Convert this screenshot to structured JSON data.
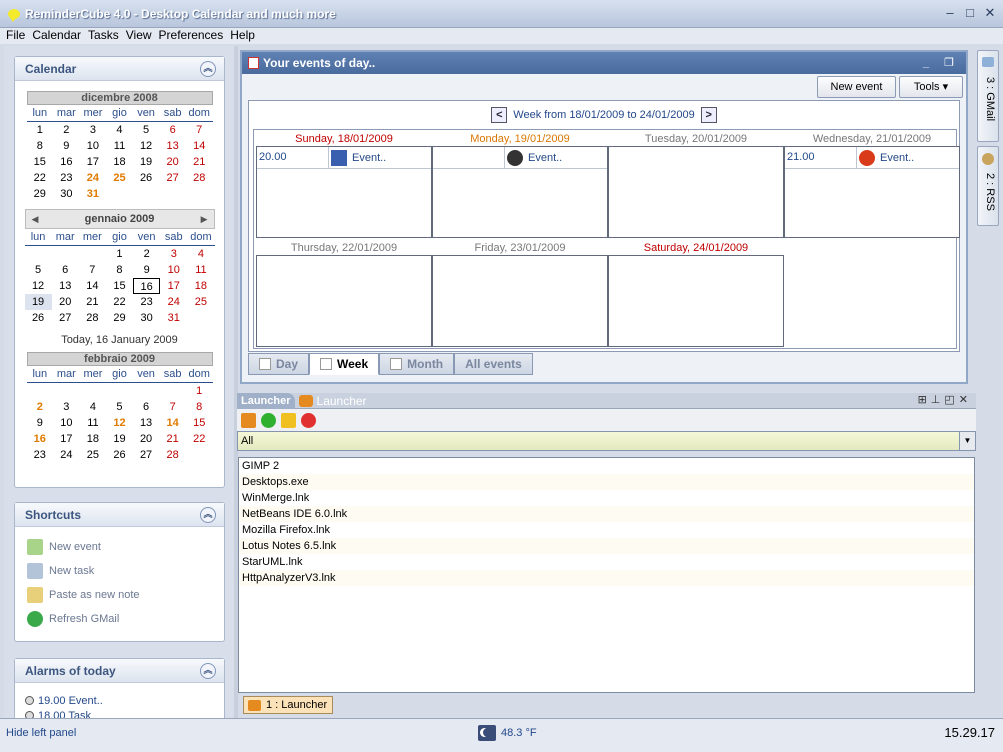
{
  "window": {
    "title": "ReminderCube 4.0 - Desktop Calendar and much more"
  },
  "menu": [
    "File",
    "Calendar",
    "Tasks",
    "View",
    "Preferences",
    "Help"
  ],
  "calendar_panel": {
    "title": "Calendar",
    "day_names": [
      "lun",
      "mar",
      "mer",
      "gio",
      "ven",
      "sab",
      "dom"
    ],
    "prev_month": {
      "title": "dicembre 2008",
      "rows": [
        [
          "1",
          "2",
          "3",
          "4",
          "5",
          "6",
          "7"
        ],
        [
          "8",
          "9",
          "10",
          "11",
          "12",
          "13",
          "14"
        ],
        [
          "15",
          "16",
          "17",
          "18",
          "19",
          "20",
          "21"
        ],
        [
          "22",
          "23",
          "24",
          "25",
          "26",
          "27",
          "28"
        ],
        [
          "29",
          "30",
          "31",
          "",
          "",
          "",
          ""
        ]
      ]
    },
    "cur_month": {
      "title": "gennaio 2009",
      "rows": [
        [
          "",
          "",
          "",
          "1",
          "2",
          "3",
          "4"
        ],
        [
          "5",
          "6",
          "7",
          "8",
          "9",
          "10",
          "11"
        ],
        [
          "12",
          "13",
          "14",
          "15",
          "16",
          "17",
          "18"
        ],
        [
          "19",
          "20",
          "21",
          "22",
          "23",
          "24",
          "25"
        ],
        [
          "26",
          "27",
          "28",
          "29",
          "30",
          "31",
          ""
        ]
      ]
    },
    "today_text": "Today, 16 January 2009",
    "next_month": {
      "title": "febbraio 2009",
      "rows": [
        [
          "",
          "",
          "",
          "",
          "",
          "",
          "1"
        ],
        [
          "2",
          "3",
          "4",
          "5",
          "6",
          "7",
          "8"
        ],
        [
          "9",
          "10",
          "11",
          "12",
          "13",
          "14",
          "15"
        ],
        [
          "16",
          "17",
          "18",
          "19",
          "20",
          "21",
          "22"
        ],
        [
          "23",
          "24",
          "25",
          "26",
          "27",
          "28",
          ""
        ]
      ]
    }
  },
  "shortcuts": {
    "title": "Shortcuts",
    "items": [
      "New event",
      "New task",
      "Paste as new note",
      "Refresh GMail"
    ]
  },
  "alarms": {
    "title": "Alarms of today",
    "items": [
      "19.00 Event..",
      "18.00 Task"
    ]
  },
  "events_window": {
    "title": "Your events of day..",
    "new_event": "New event",
    "tools": "Tools",
    "week_label": "Week from 18/01/2009 to 24/01/2009",
    "days": [
      {
        "name": "Sunday, 18/01/2009",
        "time": "20.00",
        "event": "Event.."
      },
      {
        "name": "Monday, 19/01/2009",
        "time": "",
        "event": "Event.."
      },
      {
        "name": "Tuesday, 20/01/2009",
        "time": "",
        "event": ""
      },
      {
        "name": "Wednesday, 21/01/2009",
        "time": "21.00",
        "event": "Event.."
      },
      {
        "name": "Thursday, 22/01/2009",
        "time": "",
        "event": ""
      },
      {
        "name": "Friday, 23/01/2009",
        "time": "",
        "event": ""
      },
      {
        "name": "Saturday, 24/01/2009",
        "time": "",
        "event": ""
      }
    ],
    "tabs": [
      "Day",
      "Week",
      "Month",
      "All events"
    ]
  },
  "launcher": {
    "tab_active": "Launcher",
    "tab_title": "Launcher",
    "filter": "All",
    "items": [
      "GIMP 2",
      "Desktops.exe",
      "WinMerge.lnk",
      "NetBeans IDE 6.0.lnk",
      "Mozilla Firefox.lnk",
      "Lotus Notes 6.5.lnk",
      "StarUML.lnk",
      "HttpAnalyzerV3.lnk"
    ],
    "bottom_tab": "1 : Launcher"
  },
  "right_tabs": [
    "3 : GMail",
    "2 : RSS"
  ],
  "status": {
    "hide_panel": "Hide left panel",
    "temperature": "48.3 °F",
    "clock": "15.29.17"
  }
}
